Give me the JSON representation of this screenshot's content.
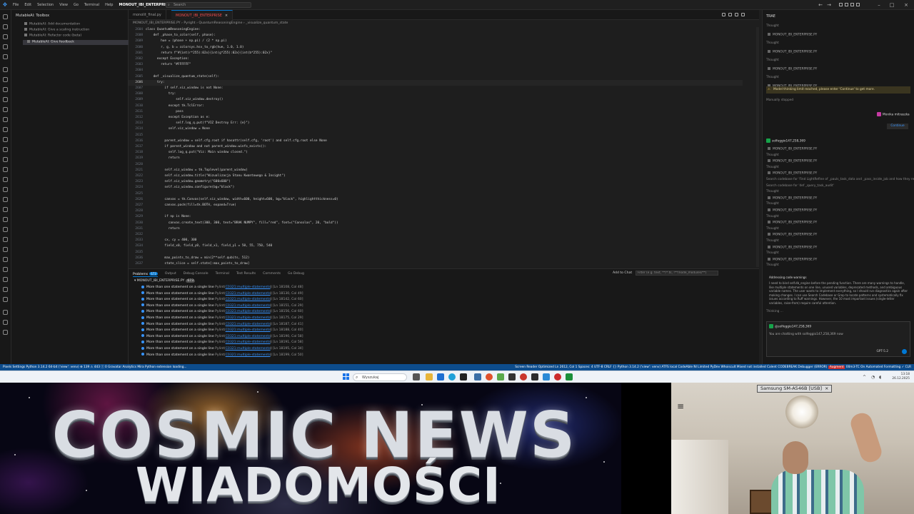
{
  "titlebar": {
    "menus": [
      "File",
      "Edit",
      "Selection",
      "View",
      "Go",
      "Terminal",
      "Help"
    ],
    "active_project": "MONOUT_IBI_ENTERPRISE",
    "search": "Search"
  },
  "sidebar": {
    "title": "MutableAI: Toolbox",
    "items": [
      "MutableAI: Add documentation",
      "MutableAI: Give a scaling instruction",
      "MutableAI: Refactor code (beta)",
      "MutableAI: Give feedback"
    ]
  },
  "editor": {
    "tabs": [
      "monolit_final.py",
      "MONOUT_IBI_ENTERPRISE"
    ],
    "breadcrumb": "MONOUT_IBI_ENTERPRISE.PY › Pyright › QuantumReasoningEngine › _visualize_quantum_state",
    "code_lines": [
      {
        "n": "2604",
        "t": "class QuantumReasoningEngine:"
      },
      {
        "n": "2608",
        "t": "    def _phase_to_color(self, phase):"
      },
      {
        "n": "2609",
        "t": "        hue = (phase + np.pi) / (2 * np.pi)"
      },
      {
        "n": "2600",
        "t": "        r, g, b = colorsys.hsv_to_rgb(hue, 1.0, 1.0)"
      },
      {
        "n": "2601",
        "t": "        return f\"#{int(r*255):02x}{int(g*255):02x}{int(b*255):02x}\""
      },
      {
        "n": "2602",
        "t": "      except Exception:"
      },
      {
        "n": "2603",
        "t": "        return \"#FFFFFF\""
      },
      {
        "n": "2604",
        "t": ""
      },
      {
        "n": "2605",
        "t": "    def _visualize_quantum_state(self):"
      },
      {
        "n": "2606",
        "t": "      try:"
      },
      {
        "n": "2607",
        "t": "          if self.viz_window is not None:"
      },
      {
        "n": "2608",
        "t": "            try:"
      },
      {
        "n": "2609",
        "t": "                self.viz_window.destroy()"
      },
      {
        "n": "2610",
        "t": "            except tk.TclError:"
      },
      {
        "n": "2611",
        "t": "                pass"
      },
      {
        "n": "2612",
        "t": "            except Exception as e:"
      },
      {
        "n": "2613",
        "t": "                self.log_q.put(f\"VIZ Destroy Err: {e}\")"
      },
      {
        "n": "2614",
        "t": "            self.viz_window = None"
      },
      {
        "n": "2615",
        "t": ""
      },
      {
        "n": "2616",
        "t": "          parent_window = self.cfg.root if hasattr(self.cfg, 'root') and self.cfg.root else None"
      },
      {
        "n": "2617",
        "t": "          if parent_window and not parent_window.winfo_exists():"
      },
      {
        "n": "2618",
        "t": "            self.log_q.put(\"Viz: Main window closed.\")"
      },
      {
        "n": "2619",
        "t": "            return"
      },
      {
        "n": "2620",
        "t": ""
      },
      {
        "n": "2621",
        "t": "          self.viz_window = tk.Toplevel(parent_window)"
      },
      {
        "n": "2622",
        "t": "          self.viz_window.title(\"Wizualizacja Stanu Kwantowego & Insight\")"
      },
      {
        "n": "2623",
        "t": "          self.viz_window.geometry(\"600x600\")"
      },
      {
        "n": "2624",
        "t": "          self.viz_window.configure(bg=\"black\")"
      },
      {
        "n": "2625",
        "t": ""
      },
      {
        "n": "2626",
        "t": "          canvas = tk.Canvas(self.viz_window, width=600, height=600, bg=\"black\", highlightthickness=0)"
      },
      {
        "n": "2627",
        "t": "          canvas.pack(fill=tk.BOTH, expand=True)"
      },
      {
        "n": "2628",
        "t": ""
      },
      {
        "n": "2629",
        "t": "          if np is None:"
      },
      {
        "n": "2630",
        "t": "            canvas.create_text(300, 300, text=\"BRAK NUMPY\", fill=\"red\", font=(\"Consolas\", 20, \"bold\"))"
      },
      {
        "n": "2631",
        "t": "            return"
      },
      {
        "n": "2632",
        "t": ""
      },
      {
        "n": "2633",
        "t": "          cx, cy = 400, 300"
      },
      {
        "n": "2634",
        "t": "          field_x0, field_y0, field_x1, field_y1 = 50, 55, 750, 540"
      },
      {
        "n": "2635",
        "t": ""
      },
      {
        "n": "2636",
        "t": "          max_points_to_draw = min(2**self.qubits, 512)"
      },
      {
        "n": "2637",
        "t": "          state_slice = self.state[:max_points_to_draw]"
      }
    ]
  },
  "panel": {
    "tabs": [
      "Problems",
      "Output",
      "Debug Console",
      "Terminal",
      "Test Results",
      "Comments",
      "Go Debug"
    ],
    "problems_count": "673",
    "add_to_chat": "Add to Chat",
    "filter_placeholder": "Filter (e.g. text, **/*.ts, !**/node_modules/**)",
    "file_group": "MONOUT_IBI_ENTERPRISE.PY",
    "file_count": "673",
    "problems": [
      {
        "msg": "More than one statement on a single line",
        "src": "Pylint(",
        "code": "C0321:multiple-statements",
        "pos": "[Ln 18108, Col 48]"
      },
      {
        "msg": "More than one statement on a single line",
        "src": "Pylint(",
        "code": "C0321:multiple-statements",
        "pos": "[Ln 18130, Col 49]"
      },
      {
        "msg": "More than one statement on a single line",
        "src": "Pylint(",
        "code": "C0321:multiple-statements",
        "pos": "[Ln 18142, Col 60]"
      },
      {
        "msg": "More than one statement on a single line",
        "src": "Pylint(",
        "code": "C0321:multiple-statements",
        "pos": "[Ln 18151, Col 29]"
      },
      {
        "msg": "More than one statement on a single line",
        "src": "Pylint(",
        "code": "C0321:multiple-statements",
        "pos": "[Ln 18156, Col 60]"
      },
      {
        "msg": "More than one statement on a single line",
        "src": "Pylint(",
        "code": "C0321:multiple-statements",
        "pos": "[Ln 18175, Col 29]"
      },
      {
        "msg": "More than one statement on a single line",
        "src": "Pylint(",
        "code": "C0321:multiple-statements",
        "pos": "[Ln 18187, Col 41]"
      },
      {
        "msg": "More than one statement on a single line",
        "src": "Pylint(",
        "code": "C0321:multiple-statements",
        "pos": "[Ln 18188, Col 40]"
      },
      {
        "msg": "More than one statement on a single line",
        "src": "Pylint(",
        "code": "C0321:multiple-statements",
        "pos": "[Ln 18190, Col 58]"
      },
      {
        "msg": "More than one statement on a single line",
        "src": "Pylint(",
        "code": "C0321:multiple-statements",
        "pos": "[Ln 18191, Col 58]"
      },
      {
        "msg": "More than one statement on a single line",
        "src": "Pylint(",
        "code": "C0321:multiple-statements",
        "pos": "[Ln 18195, Col 34]"
      },
      {
        "msg": "More than one statement on a single line",
        "src": "Pylint(",
        "code": "C0321:multiple-statements",
        "pos": "[Ln 18199, Col 50]"
      }
    ]
  },
  "chat": {
    "title": "TRAE",
    "thought_label": "Thought",
    "file_label": "MONOUT_IBI_ENTERPRISE.PY",
    "warning": "Model thinking limit reached, please enter 'Continue' to get more.",
    "stopped": "Manually stopped",
    "user_name": "Monika mitraszka",
    "continue": "Continue",
    "bot_name": "solfeggio147,258,369",
    "search1": "Search codebase for 'Find LightRefine of _pauls_task_data and _pass_inside_job and how they return typ...'",
    "search2": "Search codebase for 'def _query_task_audit'",
    "section": "Addressing code warnings",
    "para": "I need to bind self.db_engine before the pending function. There are many warnings to handle, like multiple statements on one line, unused variables, deprecated methods, and ambiguous variable names. The user wants to implement everything, so I should run diagnostics again after making changes. I can use Search Codebase or Grep to locate patterns and systematically fix issues according to Ruff warnings. However, the 10 most important issues (single-letter variables, raise-from) require careful attention.",
    "thinking": "Thinking ...",
    "foot_name": "@solfeggio147,258,369",
    "foot_text": "You are chatting with solfeggio147,258,369 now",
    "model": "GPT-5.2"
  },
  "statusbar": {
    "left": "Pixels Settings   Python 3.14.2 64-bit ('view': venv)   ⊗ 139  ⚠ 443  ⓘ 0   Gravatar Analytics   Mira   Python extension loading...",
    "right": "Screen Reader Optimized   Ln 2612, Col 1   Spaces: 4   UTF-8   CRLF   {} Python   3.14.2 ('view': venv)   ATFS   local   CodeAble   Nl Limited   PyDev   Whoiscult   Mixed not installed   Calent   CODEBREAK   Debugger (ERROR)",
    "flag": "Augment",
    "right2": "00m3-TC On   Automated   Formatting   ✓ CLR"
  },
  "taskbar": {
    "search": "Wyszukaj",
    "time": "13:18",
    "date": "26.12.2025"
  },
  "banner": {
    "line1": "COSMIC NEWS",
    "line2": "WIADOMOŚCI"
  },
  "webcam": {
    "tag": "Samsung SM-A546B [USB]",
    "close": "×",
    "menu": "≡"
  },
  "colors": {
    "accent": "#0078d4",
    "statusbar": "#0d4c8c",
    "error_tab": "#f14c4c",
    "warning_bg": "#3a3520"
  }
}
